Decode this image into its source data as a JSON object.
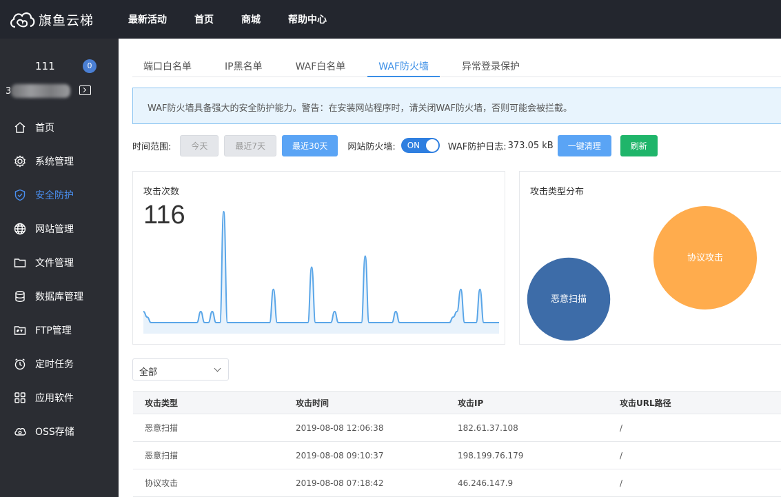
{
  "brand": {
    "name": "旗鱼云梯"
  },
  "topnav": [
    "最新活动",
    "首页",
    "商城",
    "帮助中心"
  ],
  "user": {
    "name": "111",
    "badge": "0",
    "id_prefix": "3"
  },
  "menu": [
    {
      "label": "首页",
      "icon": "home-icon"
    },
    {
      "label": "系统管理",
      "icon": "gear-icon"
    },
    {
      "label": "安全防护",
      "icon": "shield-icon",
      "active": true
    },
    {
      "label": "网站管理",
      "icon": "globe-icon"
    },
    {
      "label": "文件管理",
      "icon": "folder-icon"
    },
    {
      "label": "数据库管理",
      "icon": "database-icon"
    },
    {
      "label": "FTP管理",
      "icon": "ftp-icon"
    },
    {
      "label": "定时任务",
      "icon": "clock-icon"
    },
    {
      "label": "应用软件",
      "icon": "apps-icon"
    },
    {
      "label": "OSS存储",
      "icon": "cloud-icon"
    }
  ],
  "tabs": [
    "端口白名单",
    "IP黑名单",
    "WAF白名单",
    "WAF防火墙",
    "异常登录保护"
  ],
  "active_tab": "WAF防火墙",
  "notice": "WAF防火墙具备强大的安全防护能力。警告：在安装网站程序时，请关闭WAF防火墙，否则可能会被拦截。",
  "controls": {
    "time_range_label": "时间范围:",
    "today": "今天",
    "last7": "最近7天",
    "last30": "最近30天",
    "firewall_label": "网站防火墙:",
    "toggle_state": "ON",
    "log_label": "WAF防护日志:",
    "log_size": "373.05 kB",
    "clear": "一键清理",
    "refresh": "刷新"
  },
  "attack_count": {
    "title": "攻击次数",
    "value": "116"
  },
  "attack_types": {
    "title": "攻击类型分布"
  },
  "chart_data": [
    {
      "type": "area",
      "values": [
        2,
        1,
        0,
        0,
        0,
        0,
        0,
        0,
        0,
        0,
        0,
        0,
        0,
        0,
        0,
        2,
        0,
        0,
        2,
        0,
        0,
        20,
        0,
        0,
        0,
        0,
        0,
        0,
        0,
        0,
        0,
        0,
        0,
        0,
        6,
        0,
        0,
        0,
        0,
        0,
        0,
        0,
        0,
        0,
        10,
        0,
        0,
        0,
        0,
        0,
        2,
        0,
        0,
        0,
        0,
        0,
        0,
        0,
        12,
        0,
        0,
        0,
        0,
        0,
        0,
        0,
        2,
        0,
        0,
        0,
        0,
        0,
        0,
        0,
        0,
        0,
        0,
        0,
        0,
        0,
        0,
        1,
        2,
        6,
        0,
        0,
        0,
        0,
        6,
        0,
        0,
        0,
        0,
        0
      ]
    },
    {
      "type": "bubble",
      "series": [
        {
          "name": "恶意扫描",
          "color": "#3d6ca8",
          "value": 40
        },
        {
          "name": "协议攻击",
          "color": "#ffac4d",
          "value": 62
        }
      ]
    }
  ],
  "filter": {
    "selected": "全部"
  },
  "table": {
    "headers": [
      "攻击类型",
      "攻击时间",
      "攻击IP",
      "攻击URL路径"
    ],
    "rows": [
      [
        "恶意扫描",
        "2019-08-08 12:06:38",
        "182.61.37.108",
        "/"
      ],
      [
        "恶意扫描",
        "2019-08-08 09:10:37",
        "198.199.76.179",
        "/"
      ],
      [
        "协议攻击",
        "2019-08-08 07:18:42",
        "46.246.147.9",
        "/"
      ]
    ]
  }
}
